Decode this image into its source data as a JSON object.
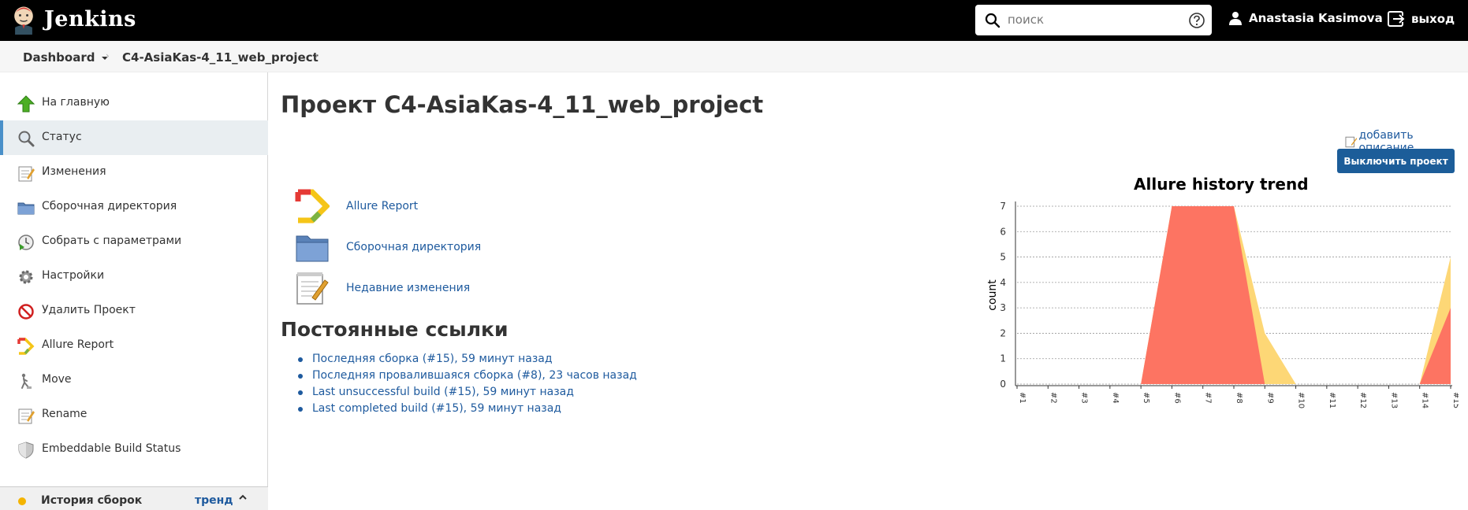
{
  "app": {
    "name": "Jenkins"
  },
  "header": {
    "search_placeholder": "поиск",
    "user_name": "Anastasia Kasimova",
    "logout_label": "выход"
  },
  "breadcrumbs": [
    {
      "label": "Dashboard"
    },
    {
      "label": "C4-AsiaKas-4_11_web_project"
    }
  ],
  "sidebar": {
    "items": [
      {
        "label": "На главную",
        "icon": "up-arrow-icon"
      },
      {
        "label": "Статус",
        "icon": "search-icon",
        "active": true
      },
      {
        "label": "Изменения",
        "icon": "notepad-icon"
      },
      {
        "label": "Сборочная директория",
        "icon": "folder-icon"
      },
      {
        "label": "Собрать с параметрами",
        "icon": "clock-play-icon"
      },
      {
        "label": "Настройки",
        "icon": "gear-icon"
      },
      {
        "label": "Удалить Проект",
        "icon": "no-entry-icon"
      },
      {
        "label": "Allure Report",
        "icon": "allure-icon"
      },
      {
        "label": "Move",
        "icon": "move-icon"
      },
      {
        "label": "Rename",
        "icon": "notepad-icon"
      },
      {
        "label": "Embeddable Build Status",
        "icon": "shield-icon"
      }
    ],
    "history_label": "История сборок",
    "history_trend": "тренд"
  },
  "main": {
    "title": "Проект C4-AsiaKas-4_11_web_project",
    "add_description": "добавить описание",
    "disable_button": "Выключить проект",
    "links": [
      {
        "label": "Allure Report",
        "icon": "allure-icon"
      },
      {
        "label": "Сборочная директория",
        "icon": "folder-icon"
      },
      {
        "label": "Недавние изменения",
        "icon": "notepad-icon"
      }
    ],
    "permalinks_title": "Постоянные ссылки",
    "permalinks": [
      "Последняя сборка (#15), 59 минут назад",
      "Последняя провалившаяся сборка (#8), 23 часов назад",
      "Last unsuccessful build (#15), 59 минут назад",
      "Last completed build (#15), 59 минут назад"
    ]
  },
  "chart_data": {
    "type": "area",
    "title": "Allure history trend",
    "xlabel": "",
    "ylabel": "count",
    "categories": [
      "#1",
      "#2",
      "#3",
      "#4",
      "#5",
      "#6",
      "#7",
      "#8",
      "#9",
      "#10",
      "#11",
      "#12",
      "#13",
      "#14",
      "#15"
    ],
    "ylim": [
      0,
      7
    ],
    "yticks": [
      0,
      1,
      2,
      3,
      4,
      5,
      6,
      7
    ],
    "grid": true,
    "series": [
      {
        "color": "#fd7462",
        "values": [
          0,
          0,
          0,
          0,
          0,
          7,
          7,
          7,
          0,
          0,
          0,
          0,
          0,
          0,
          3
        ]
      },
      {
        "color": "#fdd776",
        "values": [
          0,
          0,
          0,
          0,
          0,
          7,
          7,
          7,
          2,
          0,
          0,
          0,
          0,
          0,
          5
        ]
      }
    ]
  }
}
